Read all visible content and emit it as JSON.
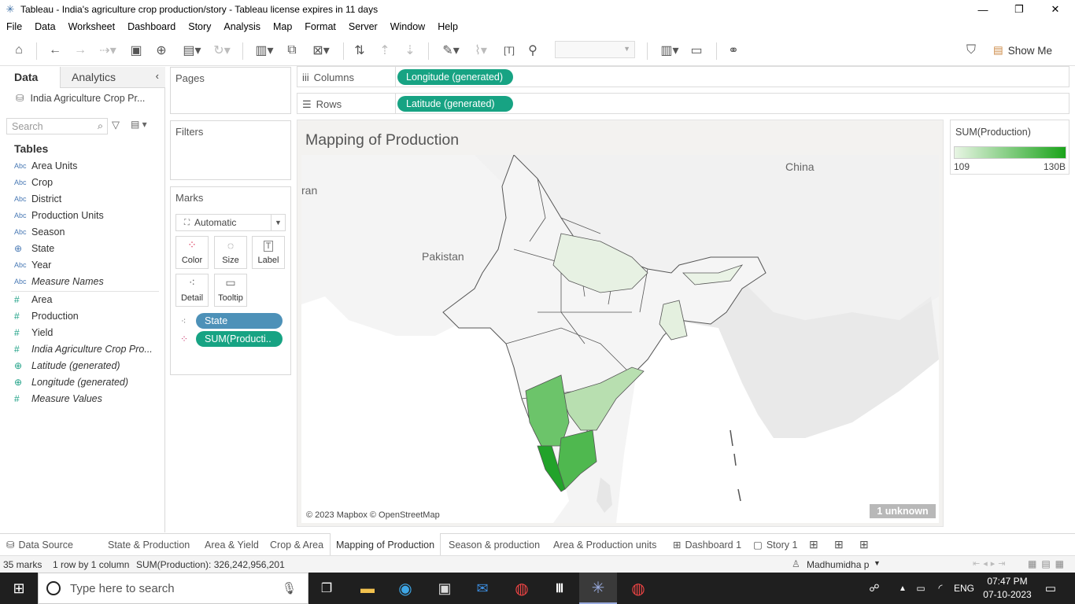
{
  "window": {
    "title": "Tableau - India's agriculture crop production/story - Tableau license expires in 11 days"
  },
  "menu": [
    "File",
    "Data",
    "Worksheet",
    "Dashboard",
    "Story",
    "Analysis",
    "Map",
    "Format",
    "Server",
    "Window",
    "Help"
  ],
  "toolbar": {
    "show_me": "Show Me"
  },
  "left_pane": {
    "tabs": [
      "Data",
      "Analytics"
    ],
    "datasource": "India Agriculture Crop Pr...",
    "search_placeholder": "Search",
    "tables_header": "Tables",
    "dimensions": [
      {
        "label": "Area Units",
        "icon": "Abc"
      },
      {
        "label": "Crop",
        "icon": "Abc"
      },
      {
        "label": "District",
        "icon": "Abc"
      },
      {
        "label": "Production Units",
        "icon": "Abc"
      },
      {
        "label": "Season",
        "icon": "Abc"
      },
      {
        "label": "State",
        "icon": "globe"
      },
      {
        "label": "Year",
        "icon": "Abc"
      },
      {
        "label": "Measure Names",
        "icon": "Abc"
      }
    ],
    "measures": [
      {
        "label": "Area",
        "icon": "#"
      },
      {
        "label": "Production",
        "icon": "#"
      },
      {
        "label": "Yield",
        "icon": "#"
      },
      {
        "label": "India Agriculture Crop Pro...",
        "icon": "#"
      },
      {
        "label": "Latitude (generated)",
        "icon": "globe"
      },
      {
        "label": "Longitude (generated)",
        "icon": "globe"
      },
      {
        "label": "Measure Values",
        "icon": "#"
      }
    ]
  },
  "cards": {
    "pages": "Pages",
    "filters": "Filters",
    "marks": "Marks",
    "mark_type": "Automatic",
    "mark_buttons": [
      "Color",
      "Size",
      "Label",
      "Detail",
      "Tooltip"
    ],
    "mark_pills": [
      "State",
      "SUM(Producti.."
    ]
  },
  "shelves": {
    "columns_label": "Columns",
    "columns_pill": "Longitude (generated)",
    "rows_label": "Rows",
    "rows_pill": "Latitude (generated)"
  },
  "sheet": {
    "title": "Mapping of Production",
    "map_labels": [
      "China",
      "Pakistan",
      "ran"
    ],
    "attribution": "© 2023 Mapbox © OpenStreetMap",
    "unknown_badge": "1 unknown"
  },
  "legend": {
    "title": "SUM(Production)",
    "min": "109",
    "max": "130B",
    "color_low": "#e8f5e4",
    "color_high": "#1aa31a"
  },
  "tabs_bottom": [
    "Data Source",
    "State & Production",
    "Area & Yield",
    "Crop & Area",
    "Mapping of Production",
    "Season & production",
    "Area & Production units",
    "Dashboard 1",
    "Story 1"
  ],
  "status": {
    "marks": "35 marks",
    "rows_cols": "1 row by 1 column",
    "sum": "SUM(Production): 326,242,956,201",
    "user": "Madhumidha p"
  },
  "taskbar": {
    "search_placeholder": "Type here to search",
    "lang": "ENG",
    "time": "07:47 PM",
    "date": "07-10-2023"
  }
}
